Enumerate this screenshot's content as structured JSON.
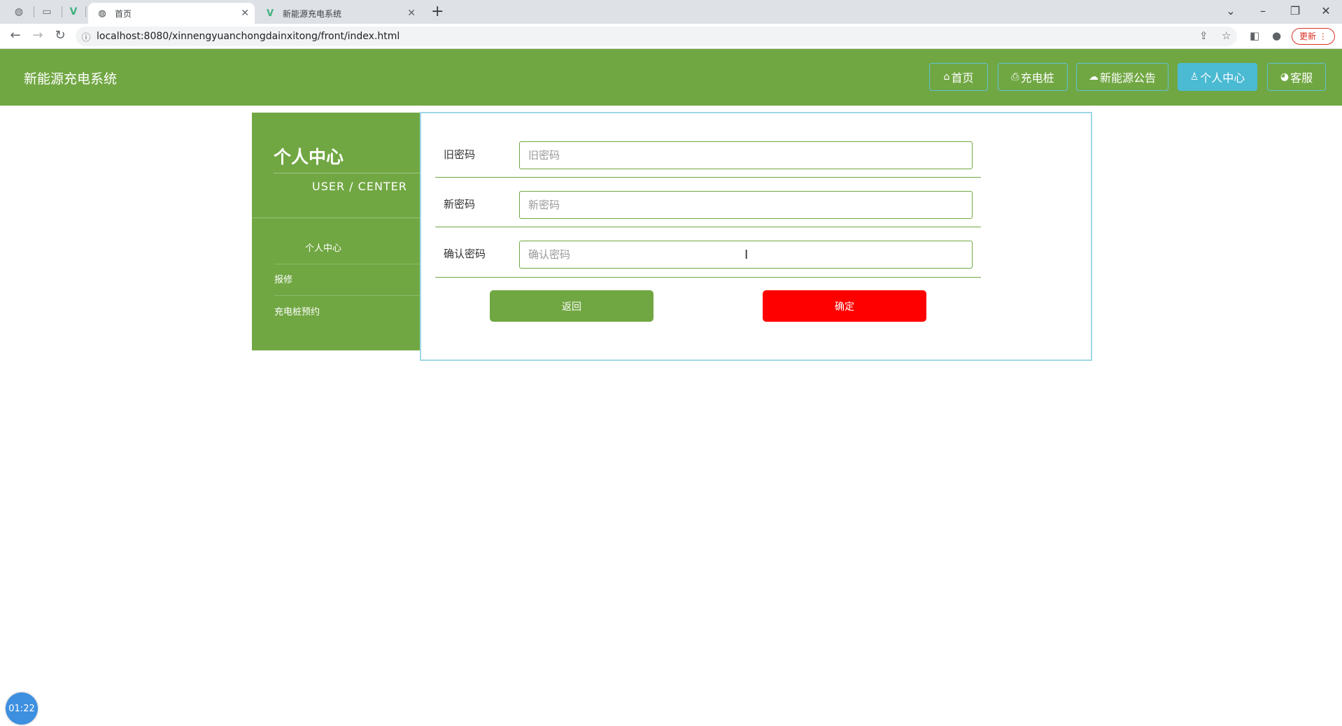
{
  "browser": {
    "tabs": [
      {
        "title": "首页",
        "active": true
      },
      {
        "title": "新能源充电系统",
        "active": false
      }
    ],
    "url": "localhost:8080/xinnengyuanchongdainxitong/front/index.html",
    "update_label": "更新"
  },
  "header": {
    "site_title": "新能源充电系统",
    "nav": [
      {
        "label": "首页",
        "icon": "home-icon",
        "active": false
      },
      {
        "label": "充电桩",
        "icon": "printer-icon",
        "active": false
      },
      {
        "label": "新能源公告",
        "icon": "cloud-icon",
        "active": false
      },
      {
        "label": "个人中心",
        "icon": "user-icon",
        "active": true
      },
      {
        "label": "客服",
        "icon": "chat-icon",
        "active": false
      }
    ]
  },
  "sidebar": {
    "title": "个人中心",
    "subtitle": "USER / CENTER",
    "items": [
      {
        "label": "个人中心",
        "active": true
      },
      {
        "label": "报修",
        "active": false
      },
      {
        "label": "充电桩预约",
        "active": false
      }
    ]
  },
  "form": {
    "fields": [
      {
        "label": "旧密码",
        "placeholder": "旧密码",
        "value": ""
      },
      {
        "label": "新密码",
        "placeholder": "新密码",
        "value": ""
      },
      {
        "label": "确认密码",
        "placeholder": "确认密码",
        "value": ""
      }
    ],
    "back_label": "返回",
    "confirm_label": "确定"
  },
  "timer": "01:22",
  "colors": {
    "brand_green": "#71a743",
    "active_nav": "#4bbad3",
    "confirm_red": "#ff0000",
    "panel_border": "#9dd8e6"
  }
}
